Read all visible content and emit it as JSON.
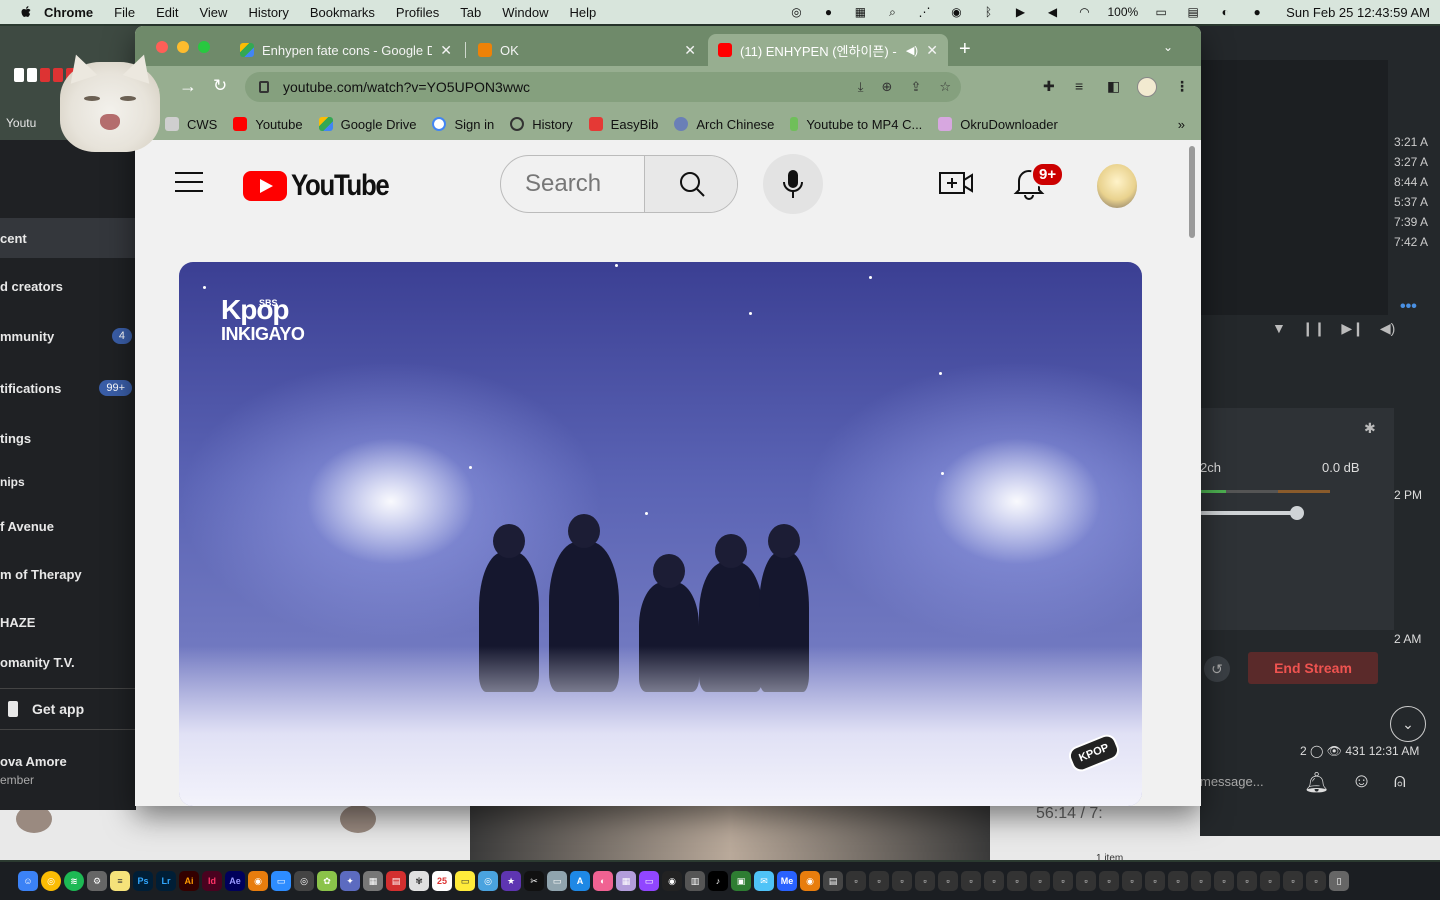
{
  "menubar": {
    "app_name": "Chrome",
    "menus": [
      "File",
      "Edit",
      "View",
      "History",
      "Bookmarks",
      "Profiles",
      "Tab",
      "Window",
      "Help"
    ],
    "battery": "100%",
    "clock": "Sun Feb 25  12:43:59 AM"
  },
  "bg_left": {
    "rows": [
      {
        "label": "cent",
        "badge": ""
      },
      {
        "label": "d creators",
        "badge": ""
      },
      {
        "label": "mmunity",
        "badge": "4"
      },
      {
        "label": "tifications",
        "badge": "99+"
      },
      {
        "label": "tings",
        "badge": ""
      },
      {
        "label": "nips",
        "badge": ""
      },
      {
        "label": "f Avenue",
        "badge": ""
      },
      {
        "label": "m of Therapy",
        "badge": ""
      },
      {
        "label": "HAZE",
        "badge": ""
      },
      {
        "label": "omanity T.V.",
        "badge": ""
      }
    ],
    "get_app": "Get app",
    "user_name": "ova Amore",
    "user_role": "ember",
    "tab_label": "Youtu"
  },
  "bg_right": {
    "times": [
      "3:21 A",
      "3:27 A",
      "8:44 A",
      "5:37 A",
      "7:39 A",
      "7:42 A"
    ],
    "more": "•••",
    "channel": "2ch",
    "db": "0.0 dB",
    "time_pm": "2 PM",
    "time_am": "2 AM",
    "end_stream": "End Stream",
    "stats": "2 ◯  👁 431 12:31 AM",
    "message_placeholder": "message..."
  },
  "bg_bottom": {
    "timecode": "56:14 / 7:",
    "items": "1 item"
  },
  "chrome": {
    "tabs": [
      {
        "title": "Enhypen fate cons - Google D",
        "favicon_color": "#4285f4"
      },
      {
        "title": "OK",
        "favicon_color": "#ee8208"
      },
      {
        "title": "(11) ENHYPEN (엔하이픈) -",
        "favicon_color": "#ff0000"
      }
    ],
    "url": "youtube.com/watch?v=YO5UPON3wwc",
    "bookmarks": [
      {
        "label": "CWS",
        "color": "#cfcfcf"
      },
      {
        "label": "Youtube",
        "color": "#ff0000"
      },
      {
        "label": "Google Drive",
        "color": "#1fa463"
      },
      {
        "label": "Sign in",
        "color": "#ffffff"
      },
      {
        "label": "History",
        "color": "#97ae90"
      },
      {
        "label": "EasyBib",
        "color": "#e53935"
      },
      {
        "label": "Arch Chinese",
        "color": "#6a7fb7"
      },
      {
        "label": "Youtube to MP4 C...",
        "color": "#6fbf5a"
      },
      {
        "label": "OkruDownloader",
        "color": "#d7a7e0"
      }
    ],
    "bookmarks_overflow": "»"
  },
  "youtube": {
    "logo_text": "YouTube",
    "search_placeholder": "Search",
    "notifications_badge": "9+",
    "video_logo_top": "Kpop",
    "video_logo_sbs": "SBS",
    "video_logo_bottom": "INKIGAYO",
    "video_stamp": "KPOP"
  }
}
